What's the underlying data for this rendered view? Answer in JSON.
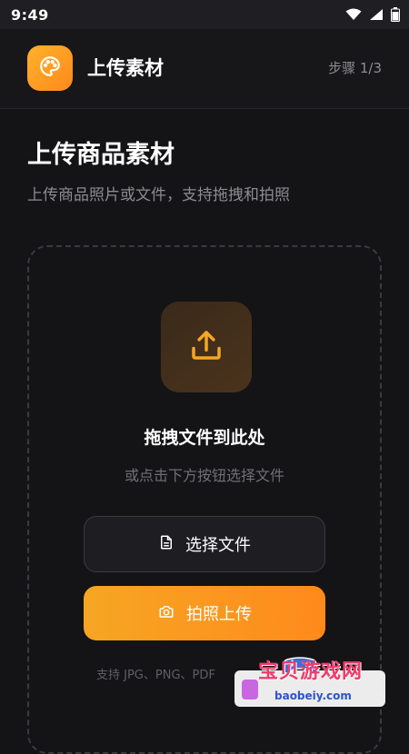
{
  "status_bar": {
    "time": "9:49",
    "icons": [
      "wifi-icon",
      "signal-icon",
      "battery-icon"
    ]
  },
  "header": {
    "app_title": "上传素材",
    "step": "步骤 1/3",
    "logo_icon": "palette-icon"
  },
  "page": {
    "title": "上传商品素材",
    "subtitle": "上传商品照片或文件，支持拖拽和拍照"
  },
  "drop_zone": {
    "icon": "upload-icon",
    "title": "拖拽文件到此处",
    "hint": "或点击下方按钮选择文件"
  },
  "buttons": {
    "choose_file": "选择文件",
    "choose_file_icon": "file-icon",
    "take_photo": "拍照上传",
    "take_photo_icon": "camera-icon"
  },
  "formats": "支持 JPG、PNG、PDF",
  "watermark": {
    "site_name": "宝贝游戏网",
    "url": "baobeiy.com"
  },
  "colors": {
    "accent": "#ff8a1c",
    "accent_light": "#f6a623",
    "background": "#141416"
  }
}
